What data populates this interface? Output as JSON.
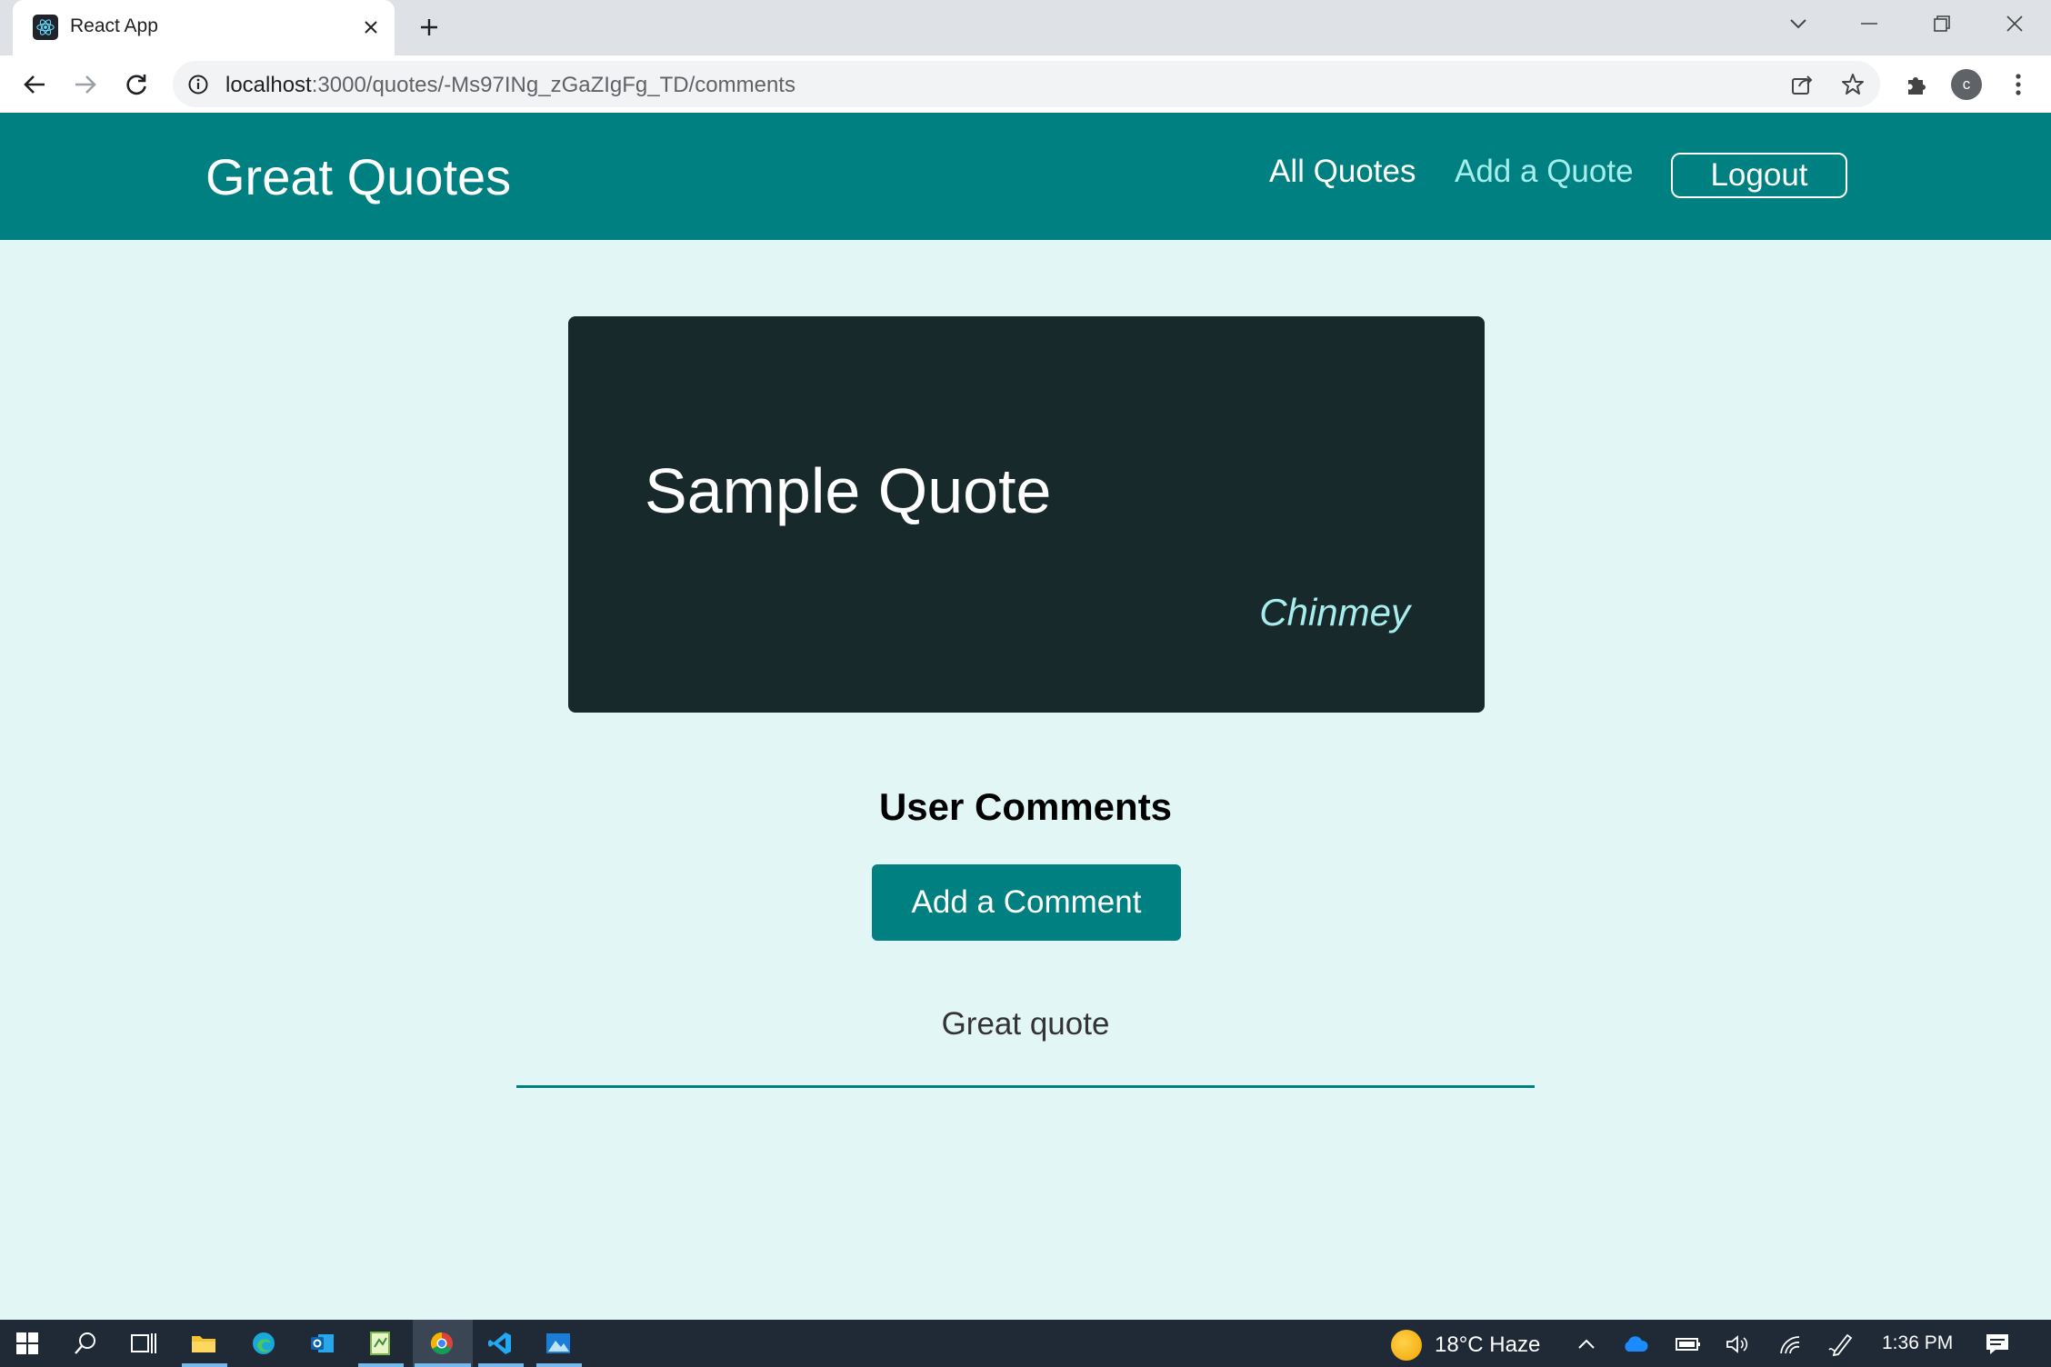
{
  "browser": {
    "tab_title": "React App",
    "url_host": "localhost",
    "url_path": ":3000/quotes/-Ms97INg_zGaZIgFg_TD/comments",
    "profile_initial": "c"
  },
  "header": {
    "brand": "Great Quotes",
    "nav": {
      "all_quotes": "All Quotes",
      "add_quote": "Add a Quote"
    },
    "logout_label": "Logout"
  },
  "quote": {
    "text": "Sample Quote",
    "author": "Chinmey"
  },
  "comments": {
    "heading": "User Comments",
    "add_button_label": "Add a Comment",
    "items": [
      {
        "text": "Great quote"
      }
    ]
  },
  "taskbar": {
    "weather_text": "18°C  Haze",
    "clock": "1:36 PM"
  },
  "colors": {
    "primary": "#008080",
    "accent": "#a6eeee",
    "page_bg": "#e3f6f6",
    "card_bg": "#18292b"
  }
}
